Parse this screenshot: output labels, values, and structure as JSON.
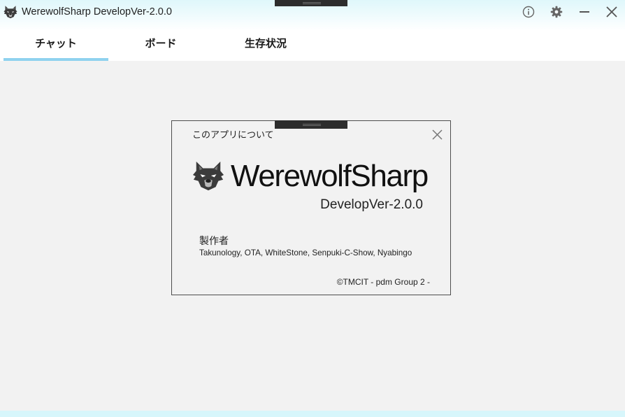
{
  "window": {
    "title": "WerewolfSharp DevelopVer-2.0.0",
    "icons": {
      "app": "wolf-icon",
      "info": "info-icon",
      "settings": "gear-icon",
      "minimize": "minimize-icon",
      "close": "close-icon"
    }
  },
  "tabs": [
    {
      "label": "チャット",
      "selected": true
    },
    {
      "label": "ボード",
      "selected": false
    },
    {
      "label": "生存状況",
      "selected": false
    }
  ],
  "about_dialog": {
    "title": "このアプリについて",
    "logo_icon": "wolf-icon",
    "close_icon": "close-icon",
    "app_name": "WerewolfSharp",
    "version": "DevelopVer-2.0.0",
    "credits_label": "製作者",
    "credits": "Takunology, OTA, WhiteStone, Senpuki-C-Show, Nyabingo",
    "copyright": "©TMCIT - pdm Group 2 -"
  },
  "colors": {
    "accent": "#8fd2ef",
    "header_tint": "#dff7fb",
    "footer_tint": "#d7f6fb",
    "content_background": "#f2f2f2",
    "dialog_border": "#4d4d4d",
    "handle": "#2d2d2d",
    "wolf": "#3b3b3b"
  }
}
